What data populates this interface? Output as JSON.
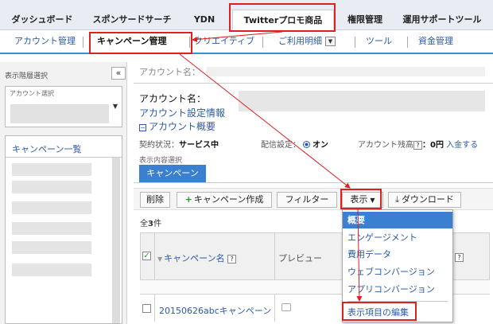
{
  "top_tabs": [
    {
      "label": "ダッシュボード"
    },
    {
      "label": "スポンサードサーチ"
    },
    {
      "label": "YDN"
    },
    {
      "label": "Twitterプロモ商品"
    },
    {
      "label": "権限管理"
    },
    {
      "label": "運用サポートツール"
    }
  ],
  "sub_nav": [
    {
      "label": "アカウント管理"
    },
    {
      "label": "キャンペーン管理"
    },
    {
      "label": "クリエイティブ"
    },
    {
      "label": "ご利用明細"
    },
    {
      "label": "ツール"
    },
    {
      "label": "資金管理"
    }
  ],
  "sidebar": {
    "hierarchy_label": "表示階層選択",
    "collapse_glyph": "«",
    "account_select_placeholder": "アカウント選択",
    "campaign_list_title": "キャンペーン一覧"
  },
  "main": {
    "breadcrumb": "アカウント名：",
    "account_name_label": "アカウント名：",
    "account_settings_link": "アカウント設定情報",
    "account_overview_link": "アカウント概要",
    "overview_toggle": "−",
    "contract_label": "契約状況：",
    "contract_value": "サービス中",
    "delivery_label": "配信設定：",
    "delivery_value": "オン",
    "balance_label": "アカウント残高",
    "help_glyph": "?",
    "balance_value": "：0円",
    "deposit_link": "入金する",
    "display_label": "表示内容選択",
    "display_tab": "キャンペーン"
  },
  "toolbar": {
    "delete": "削除",
    "create_campaign": "キャンペーン作成",
    "filter": "フィルター",
    "display": "表示",
    "download": "ダウンロード"
  },
  "table": {
    "count_prefix": "全",
    "count_value": "3",
    "count_suffix": "件",
    "col_campaign_name": "キャンペーン名",
    "col_preview": "プレビュー",
    "row_campaign": "20150626abcキャンペーン"
  },
  "display_menu": {
    "items": [
      "概要",
      "エンゲージメント",
      "費用データ",
      "ウェブコンバージョン",
      "アプリコンバージョン"
    ],
    "selected_index": 0,
    "edit_item": "表示項目の編集"
  },
  "colors": {
    "accent_blue": "#3a7fd0",
    "link_blue": "#2a5aa8",
    "highlight_red": "#e02020"
  }
}
